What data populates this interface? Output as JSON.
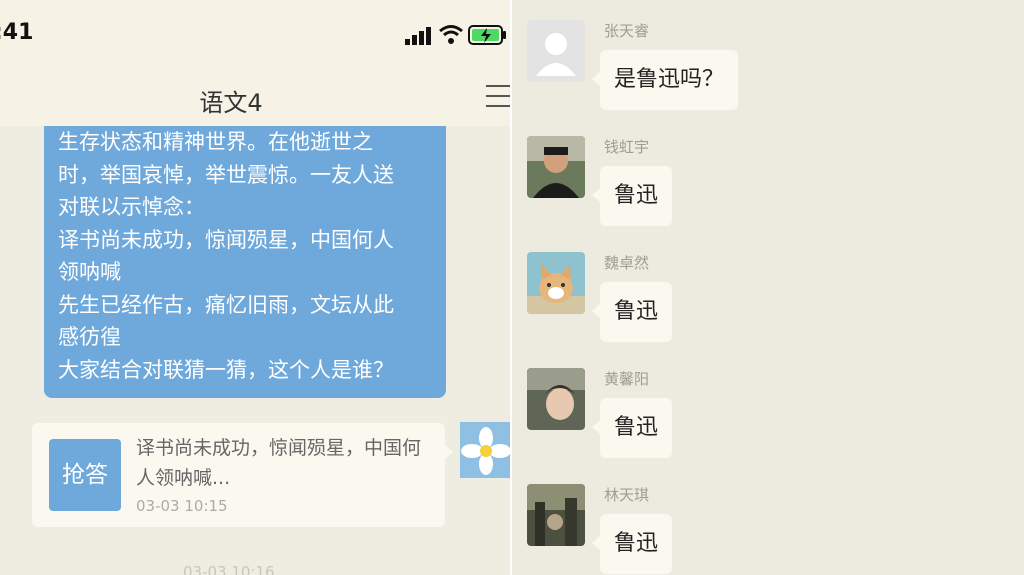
{
  "status_bar": {
    "time": ":41"
  },
  "chat": {
    "title": "语文4",
    "question_lines": [
      "生存状态和精神世界。在他逝世之",
      "时，举国哀悼，举世震惊。一友人送",
      "对联以示悼念：",
      "译书尚未成功，惊闻殒星，中国何人",
      "领呐喊",
      "先生已经作古，痛忆旧雨，文坛从此",
      "感彷徨",
      "大家结合对联猜一猜，这个人是谁？"
    ],
    "answer_card": {
      "button_label": "抢答",
      "text": "译书尚未成功，惊闻殒星，中国何人领呐喊...",
      "time": "03-03 10:15"
    },
    "next_time_partial": "03-03 10:16"
  },
  "replies": [
    {
      "name": "张天睿",
      "text": "是鲁迅吗？",
      "avatar": "default-avatar-icon"
    },
    {
      "name": "钱虹宇",
      "text": "鲁迅",
      "avatar": "boy-photo"
    },
    {
      "name": "魏卓然",
      "text": "鲁迅",
      "avatar": "cat-photo"
    },
    {
      "name": "黄馨阳",
      "text": "鲁迅",
      "avatar": "child-photo"
    },
    {
      "name": "林天琪",
      "text": "鲁迅",
      "avatar": "street-photo"
    }
  ],
  "colors": {
    "question_bubble": "#6fa9dc",
    "chat_background": "#efede2",
    "reply_bubble": "#fbf9ef"
  }
}
